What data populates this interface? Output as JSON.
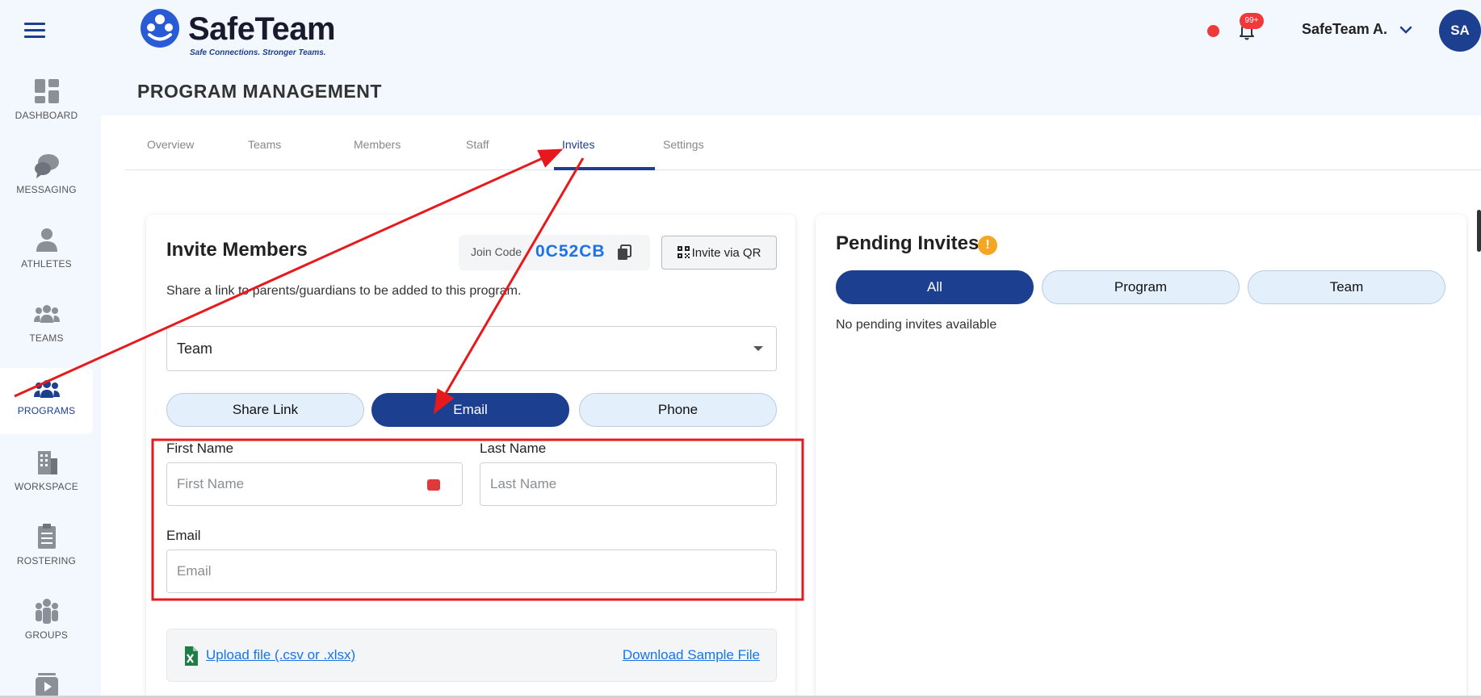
{
  "app": {
    "logo_name": "SafeTeam",
    "logo_tagline": "Safe Connections. Stronger Teams.",
    "page_title": "PROGRAM MANAGEMENT"
  },
  "header": {
    "notification_count": "99+",
    "user_name": "SafeTeam A.",
    "avatar_initials": "SA"
  },
  "sidebar": {
    "items": [
      {
        "label": "DASHBOARD",
        "icon": "dashboard-icon"
      },
      {
        "label": "MESSAGING",
        "icon": "chat-bubbles-icon"
      },
      {
        "label": "ATHLETES",
        "icon": "person-icon"
      },
      {
        "label": "TEAMS",
        "icon": "group-icon"
      },
      {
        "label": "PROGRAMS",
        "icon": "programs-icon",
        "active": true
      },
      {
        "label": "WORKSPACE",
        "icon": "building-icon"
      },
      {
        "label": "ROSTERING",
        "icon": "clipboard-icon"
      },
      {
        "label": "GROUPS",
        "icon": "groups-icon"
      }
    ]
  },
  "tabs": [
    "Overview",
    "Teams",
    "Members",
    "Staff",
    "Invites",
    "Settings"
  ],
  "active_tab": "Invites",
  "invite": {
    "title": "Invite Members",
    "join_label": "Join Code",
    "join_code": "0C52CB",
    "qr_button": "Invite via QR",
    "description": "Share a link to parents/guardians to be added to this program.",
    "select_value": "Team",
    "methods": [
      "Share Link",
      "Email",
      "Phone"
    ],
    "active_method": "Email",
    "first_name_label": "First Name",
    "first_name_placeholder": "First Name",
    "last_name_label": "Last Name",
    "last_name_placeholder": "Last Name",
    "email_label": "Email",
    "email_placeholder": "Email",
    "upload_link": "Upload file (.csv or .xlsx)",
    "download_link": "Download Sample File"
  },
  "pending": {
    "title": "Pending Invites",
    "filters": [
      "All",
      "Program",
      "Team"
    ],
    "active_filter": "All",
    "empty_text": "No pending invites available"
  },
  "colors": {
    "primary": "#1d3f8f",
    "link": "#1a73e8",
    "annotation_red": "#e8191c",
    "pill_bg": "#e3f0fc"
  }
}
